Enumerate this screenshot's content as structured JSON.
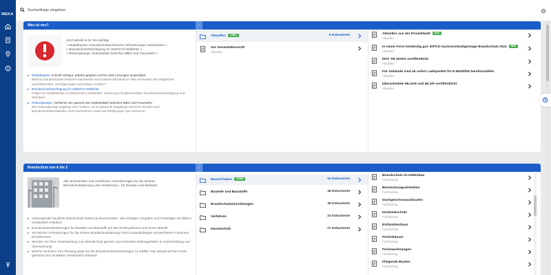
{
  "app": {
    "logo_text": "WEKA",
    "search_placeholder": "Suchanfrage eingeben",
    "rail_icons": [
      "home-icon",
      "document-icon",
      "map-pin-icon",
      "info-icon",
      "scroll-top-icon"
    ],
    "colors": {
      "primary": "#0b3f88",
      "header": "#1a5dc9",
      "badge": "#4caf50"
    }
  },
  "news": {
    "title": "Was ist neu?",
    "teaser_lead": "Jetzt aktuell & für Sie wichtig!",
    "teaser_lines": [
      "» Modulbauten: brandschutztechnische Anforderungen nachweisen «",
      "» Brandschutzertüchtigung im UNESCO-Welterbe «",
      "» Rettungswege: Drahtseilakt zwischen MBO und Feuerwehr «"
    ],
    "bullets": [
      {
        "link": "Modulbauten",
        "lead": ": schnell verbaut, präzise geplant und für viele Lösungen anwendbar",
        "sub": "Welche brandschutztechnischen Nachweise sind konkret erforderlich? Wie vermeiden Sie zeitgleichet unsichtbereiten, Verzögerungen und höhere Kosten?"
      },
      {
        "link": "Brandschutzertüchtigung im UNESCO-Welterbe",
        "lead": "",
        "sub": "Folge von Großbränden in historischen Gebäuden: Sanierung mit gleichzeitiger Brandschutzertüchtigung und Standard."
      },
      {
        "link": "Rettungswege",
        "lead": ": Vorführen Sie garniert den Drahtseilakt zwischen MBO und Feuerwehr",
        "sub": "Wie Rettungswege angelegt sein müssen, ist im Baurecht festgelegt! Dennoch berufen sich Brandschutzdienststellen und Feuerwehren meist auf Erfahrungen und Versuche."
      }
    ],
    "middle": [
      {
        "icon": "folder-icon",
        "label": "Aktuelles",
        "badge": "5 NEU",
        "count": "5 Dokumente",
        "active": true
      },
      {
        "icon": "document-icon",
        "label": "Zur Gesamtübersicht",
        "sub": "Aktuelles"
      }
    ],
    "right": [
      {
        "label": "Aktuelles aus der Produktwelt",
        "badge": "NEU",
        "sub": "Aktuelles"
      },
      {
        "label": "In neuer Form beständig gut: EIPOS-Sachverständigentage Brandschutz 2021",
        "badge": "NEU",
        "sub": "Aktuelles"
      },
      {
        "label": "MVV TB 2020/1 veröffentlicht",
        "sub": "Aktuelles"
      },
      {
        "label": "Für Gebäude sind ab sofort Ladepunkte für E-Mobilität bereitzustellen",
        "sub": "Aktuelles"
      },
      {
        "label": "Überarbeitete MLüAR und MLAR veröffentlicht",
        "sub": "Aktuelles"
      }
    ]
  },
  "az": {
    "title": "Brandschutz von A bis Z",
    "teaser_lines": [
      "Alle technischen und rechtlichen Anforderungen für die sichere",
      "Brandschutzplanung und Umsetzung – für Neubau und Bestand"
    ],
    "bullets": [
      "Vorbeugender baulicher Brandschutz konkret je Bauvorhaben: alle wichtigen Vorgaben und Praxistipps mit Bildern verständlich erläutert!",
      "Brandschutzanforderungen für Bauteile und Baustoffe auf den Punkt gebracht und immer aktuell!",
      "Technische Anforderungen für die sichere Brandschutzplanung: leicht zustandsfähiges recherchieren in diversen Einzelnormen",
      "Wenden Sie Ihrer Verantwortung zum Brandschutz gerecht und vermeiden Haftungsrisiken in Ausschreibung und Überwachung!",
      "Welche Technik in Ihre Planung passt um die Brandschutzanforderungen zu erfüllen: klar aktuell auf den Punkt gebracht und mit Bildern verständlich erläutert!"
    ],
    "middle": [
      {
        "label": "Bauvorhaben",
        "badge": "5 NEU",
        "count": "54 Dokumente",
        "active": true
      },
      {
        "label": "Bauteile und Baustoffe",
        "count": "48 Dokumente"
      },
      {
        "label": "Brandschutzeinrichtungen",
        "count": "38 Dokumente"
      },
      {
        "label": "Verfahren",
        "count": "23 Dokumente"
      },
      {
        "label": "Haustechnik",
        "count": "27 Dokumente"
      }
    ],
    "right": [
      {
        "label": "Brandschutz im Hallenbau",
        "sub": "Fachbeitrag"
      },
      {
        "label": "Büronutzungseinheiten",
        "sub": "Fachbeitrag"
      },
      {
        "label": "Dachgeschossausbauten",
        "sub": "Fachbeitrag"
      },
      {
        "label": "Denkmalschutz",
        "sub": "Fachbeitrag"
      },
      {
        "label": "Einfamilienhaus",
        "sub": "Fachbeitrag"
      },
      {
        "label": "Ferienhäuser",
        "sub": "Fachbeitrag"
      },
      {
        "label": "Ferienwohnungen",
        "sub": "Fachbeitrag"
      },
      {
        "label": "Fliegende Bauten",
        "sub": "Fachbeitrag"
      }
    ]
  }
}
